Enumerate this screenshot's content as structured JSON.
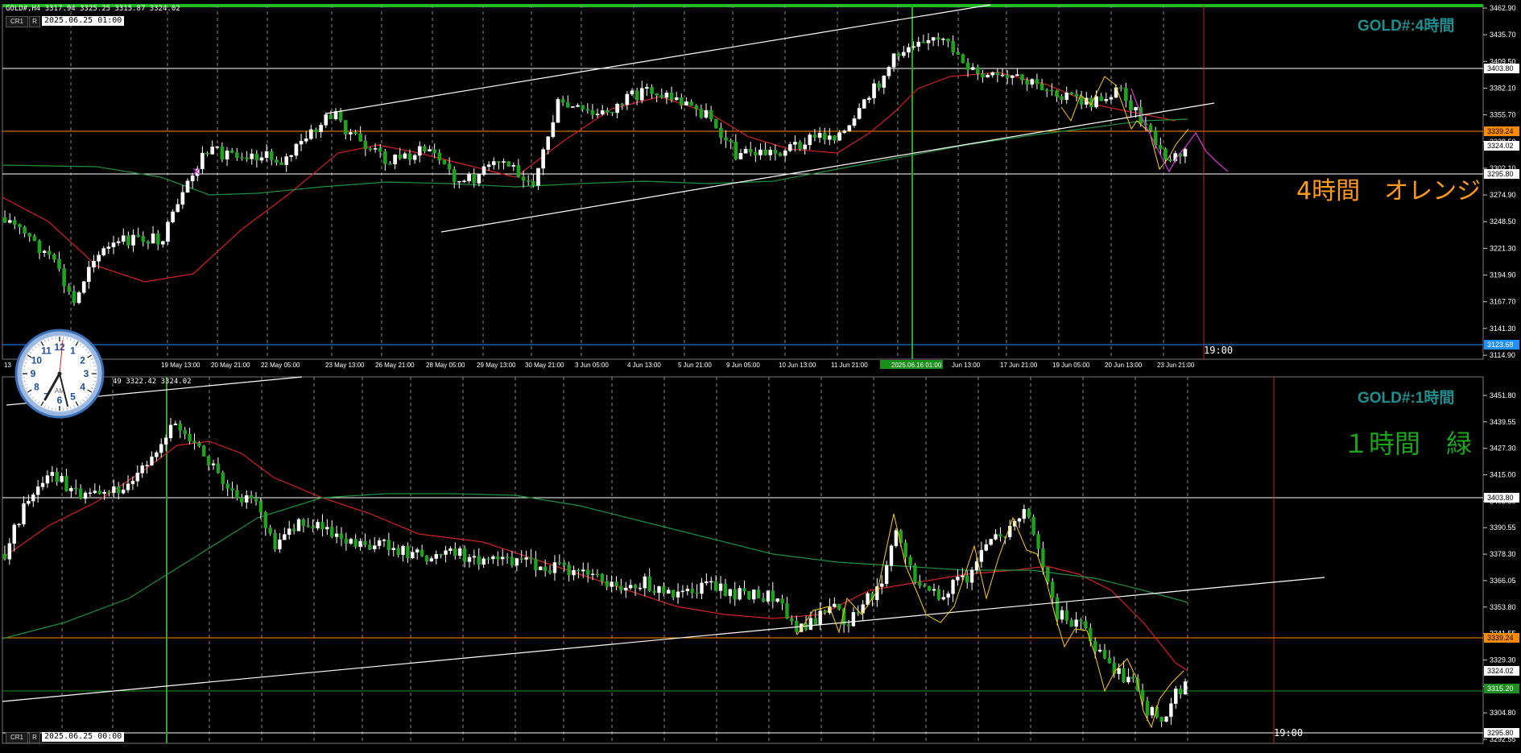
{
  "top": {
    "header": "GOLD#,H4  3317.94 3325.25 3315.87 3324.02",
    "btn_cr": "CR1",
    "btn_r": "R",
    "datetime": "2025.06.25 01:00",
    "title": "GOLD#:4時間",
    "note": "4時間　オレンジ",
    "note_color": "#ff9a1a",
    "time_marker": "19:00",
    "price_axis": [
      "3462.90",
      "3435.70",
      "3409.50",
      "3382.10",
      "3355.70",
      "3328.50",
      "3302.10",
      "3274.90",
      "3248.50",
      "3221.30",
      "3194.90",
      "3167.70",
      "3141.30",
      "3114.90"
    ],
    "price_tags": [
      {
        "label": "3403.80",
        "color": "#ffffff",
        "text": "#000000"
      },
      {
        "label": "3339.24",
        "color": "#ff8c00",
        "text": "#000000"
      },
      {
        "label": "3324.02",
        "color": "#ffffff",
        "text": "#000000"
      },
      {
        "label": "3295.80",
        "color": "#ffffff",
        "text": "#000000"
      },
      {
        "label": "3123.68",
        "color": "#1e90ff",
        "text": "#ffffff"
      }
    ],
    "time_axis": [
      "13",
      "6 May 05:00",
      "19 May 13:00",
      "20 May 21:00",
      "22 May 05:00",
      "23 May 13:00",
      "26 May 21:00",
      "28 May 05:00",
      "29 May 13:00",
      "30 May 21:00",
      "3 Jun 05:00",
      "4 Jun 13:00",
      "5 Jun 21:00",
      "9 Jun 05:00",
      "10 Jun 13:00",
      "11 Jun 21:00",
      "2025.06.16 01:00",
      "Jun 13:00",
      "17 Jun 21:00",
      "19 Jun 05:00",
      "20 Jun 13:00",
      "23 Jun 21:00"
    ]
  },
  "bottom": {
    "header": "49 3322.42 3324.02",
    "btn_cr": "CR1",
    "btn_r": "R",
    "datetime": "2025.06.25 00:00",
    "title": "GOLD#:1時間",
    "note": "１時間　緑",
    "note_color": "#1aa51a",
    "time_marker": "19:00",
    "price_axis": [
      "3451.80",
      "3439.55",
      "3427.30",
      "3415.00",
      "3403.80",
      "3390.55",
      "3378.30",
      "3366.05",
      "3353.80",
      "3341.55",
      "3329.30",
      "3317.05",
      "3304.80",
      "3292.55"
    ],
    "price_tags": [
      {
        "label": "3403.80",
        "color": "#ffffff",
        "text": "#000000"
      },
      {
        "label": "3339.24",
        "color": "#ff8c00",
        "text": "#000000"
      },
      {
        "label": "3324.02",
        "color": "#ffffff",
        "text": "#000000"
      },
      {
        "label": "3315.20",
        "color": "#1e8f1e",
        "text": "#ffffff"
      },
      {
        "label": "3295.80",
        "color": "#ffffff",
        "text": "#000000"
      }
    ]
  },
  "clock": {
    "numbers": [
      "12",
      "1",
      "2",
      "3",
      "4",
      "5",
      "6",
      "7",
      "8",
      "9",
      "10",
      "11"
    ],
    "label": "AM"
  }
}
